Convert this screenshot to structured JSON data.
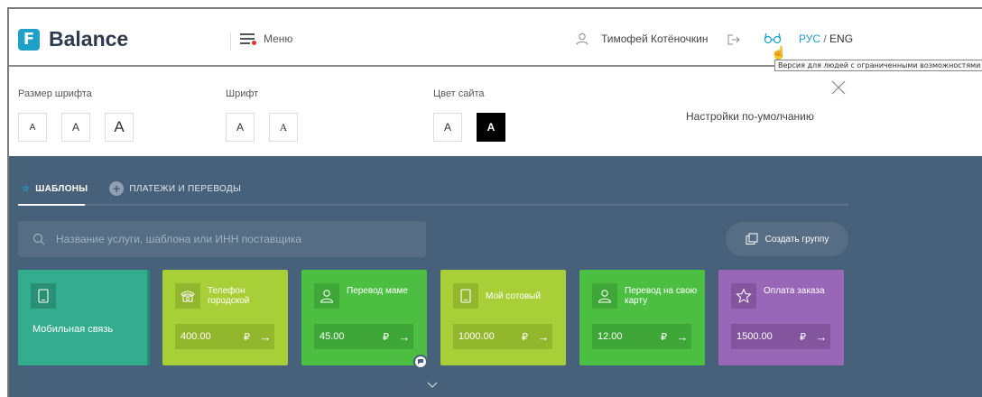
{
  "header": {
    "logo_mark": "F",
    "logo_text": "Balance",
    "menu_label": "Меню",
    "user_name": "Тимофей Котёночкин",
    "lang_ru": "РУС",
    "lang_sep": " / ",
    "lang_en": "ENG",
    "tooltip": "Версия для людей с ограниченными возможностями"
  },
  "accessibility": {
    "font_size_label": "Размер шрифта",
    "font_label": "Шрифт",
    "color_label": "Цвет сайта",
    "size_buttons": [
      "A",
      "A",
      "A"
    ],
    "font_buttons": [
      "A",
      "A"
    ],
    "color_buttons": [
      "A",
      "A"
    ],
    "defaults_label": "Настройки по-умолчанию"
  },
  "main": {
    "tabs": [
      {
        "label": "ШАБЛОНЫ",
        "active": true
      },
      {
        "label": "ПЛАТЕЖИ И ПЕРЕВОДЫ",
        "active": false
      }
    ],
    "search_placeholder": "Название услуги, шаблона или ИНН поставщика",
    "create_group_label": "Создать группу",
    "cards": [
      {
        "title": "Мобильная связь",
        "icon": "phone-icon",
        "color": "#34ad8e"
      },
      {
        "title": "Телефон городской",
        "amount": "400.00",
        "currency": "₽",
        "icon": "telephone-icon",
        "color": "#a9cf38"
      },
      {
        "title": "Перевод маме",
        "amount": "45.00",
        "currency": "₽",
        "icon": "person-icon",
        "color": "#4cbf42"
      },
      {
        "title": "Мой сотовый",
        "amount": "1000.00",
        "currency": "₽",
        "icon": "phone-icon",
        "color": "#a9cf38"
      },
      {
        "title": "Перевод на свою карту",
        "amount": "12.00",
        "currency": "₽",
        "icon": "person-icon",
        "color": "#4cbf42"
      },
      {
        "title": "Оплата заказа",
        "amount": "1500.00",
        "currency": "₽",
        "icon": "star-icon",
        "color": "#9867b7"
      }
    ]
  },
  "colors": {
    "brand": "#1fa0c6",
    "panel": "#48617a"
  }
}
